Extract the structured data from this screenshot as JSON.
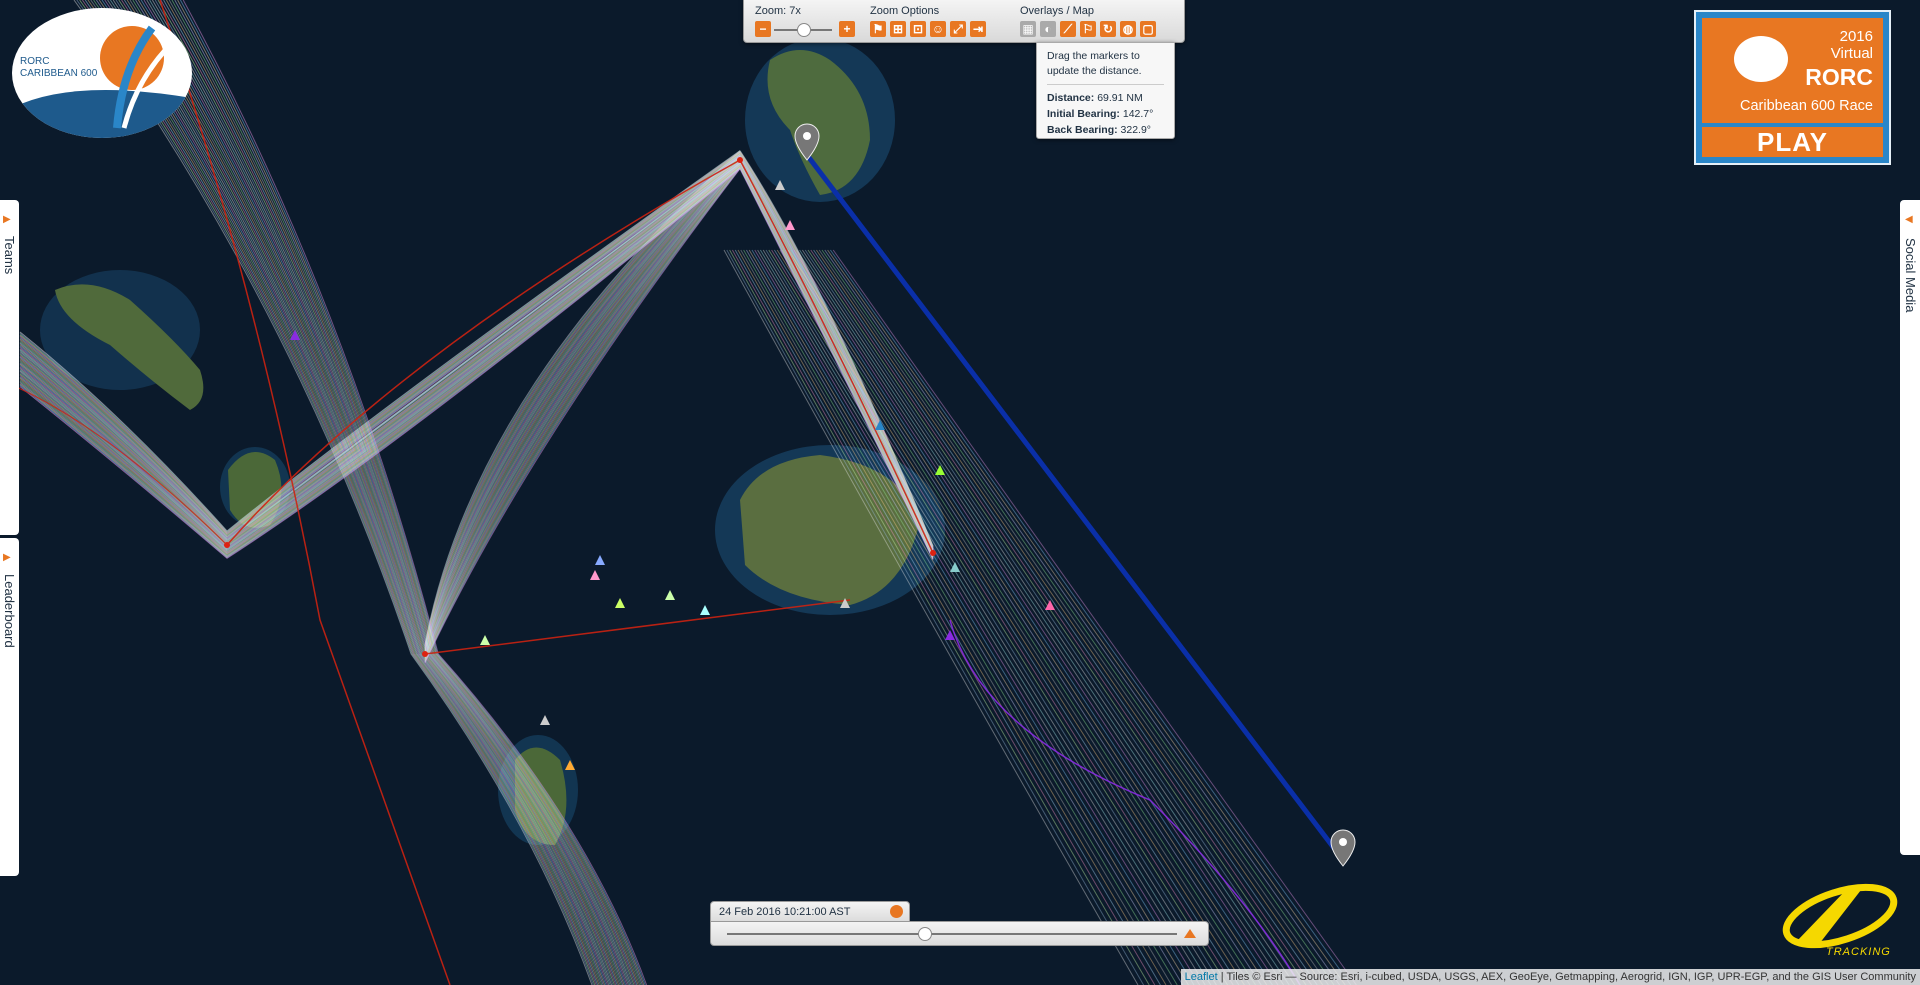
{
  "zoom": {
    "label": "Zoom: 7x"
  },
  "zoom_options": {
    "label": "Zoom Options"
  },
  "overlays": {
    "label": "Overlays / Map"
  },
  "popup": {
    "hint": "Drag the markers to update the distance.",
    "distance_label": "Distance:",
    "distance_value": "69.91 NM",
    "initial_bearing_label": "Initial Bearing:",
    "initial_bearing_value": "142.7°",
    "back_bearing_label": "Back Bearing:",
    "back_bearing_value": "322.9°"
  },
  "logo": {
    "line1": "RORC",
    "line2": "CARIBBEAN 600"
  },
  "virtual_banner": {
    "year": "2016",
    "word": "Virtual",
    "brand": "RORC",
    "race": "Caribbean 600 Race",
    "play": "PLAY"
  },
  "side_tabs": {
    "teams": "Teams",
    "leaderboard": "Leaderboard",
    "social": "Social Media"
  },
  "timeline": {
    "date": "24 Feb 2016 10:21:00 AST"
  },
  "yb": {
    "brand": "TRACKING"
  },
  "attribution": {
    "leaflet": "Leaflet",
    "tiles": " | Tiles © Esri — Source: Esri, i-cubed, USDA, USGS, AEX, GeoEye, Getmapping, Aerogrid, IGN, IGP, UPR-EGP, and the GIS User Community"
  },
  "colors": {
    "accent": "#e87722",
    "sea": "#0b1a2b",
    "ruler": "#0a2fa8"
  },
  "icons": [
    "zoom-out-icon",
    "zoom-in-icon",
    "flag-icon",
    "plus-box-icon",
    "fit-icon",
    "group-icon",
    "expand-icon",
    "exit-icon",
    "grid-icon",
    "shade-icon",
    "ruler-icon",
    "course-icon",
    "wind-icon",
    "globe-icon",
    "square-icon",
    "clock-icon",
    "play-icon",
    "map-marker-icon"
  ]
}
